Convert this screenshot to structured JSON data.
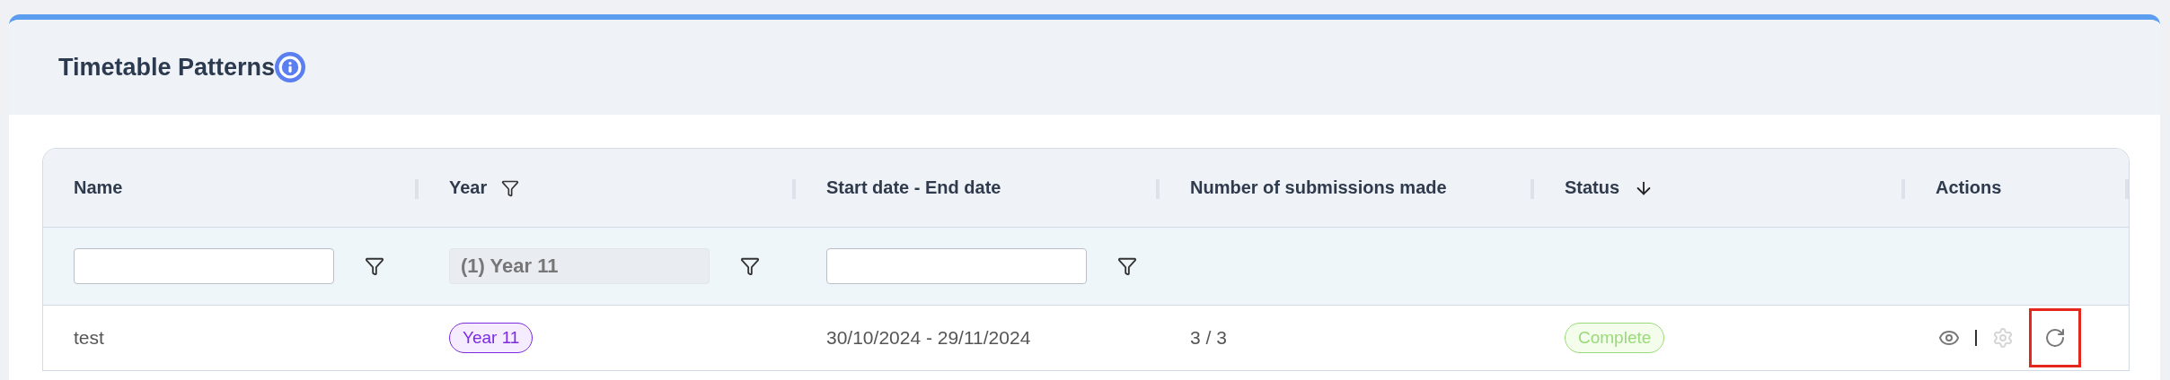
{
  "card": {
    "title": "Timetable Patterns"
  },
  "table": {
    "columns": [
      {
        "label": "Name",
        "filter": true,
        "sorted": false,
        "filter_disabled": false,
        "header_filter_icon": false
      },
      {
        "label": "Year",
        "filter": true,
        "sorted": false,
        "filter_value": "(1) Year 11",
        "filter_disabled": true,
        "header_filter_icon": true
      },
      {
        "label": "Start date - End date",
        "filter": true,
        "sorted": false,
        "filter_disabled": false,
        "header_filter_icon": false
      },
      {
        "label": "Number of submissions made",
        "filter": false,
        "sorted": false,
        "header_filter_icon": false
      },
      {
        "label": "Status",
        "filter": false,
        "sorted": true,
        "header_filter_icon": false
      },
      {
        "label": "Actions",
        "filter": false,
        "sorted": false,
        "header_filter_icon": false
      }
    ],
    "rows": [
      {
        "name": "test",
        "year": "Year 11",
        "dates": "30/10/2024 - 29/11/2024",
        "submissions": "3 / 3",
        "status": "Complete",
        "actions": [
          {
            "kind": "view",
            "disabled": false,
            "highlighted": false
          },
          {
            "kind": "settings",
            "disabled": true,
            "highlighted": false
          },
          {
            "kind": "refresh",
            "disabled": false,
            "highlighted": true
          }
        ]
      }
    ]
  }
}
